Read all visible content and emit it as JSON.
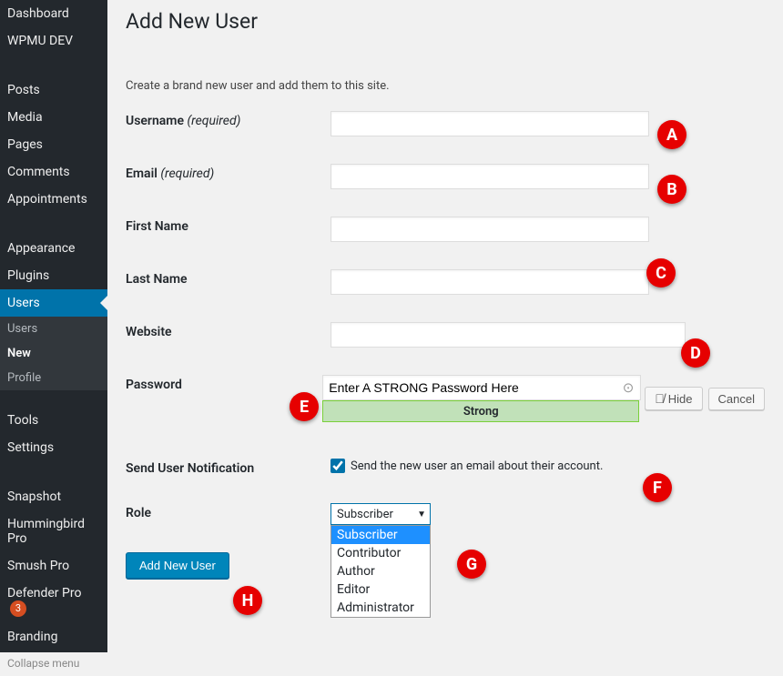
{
  "sidebar": {
    "items": [
      {
        "label": "Dashboard"
      },
      {
        "label": "WPMU DEV"
      },
      {
        "label": "Posts"
      },
      {
        "label": "Media"
      },
      {
        "label": "Pages"
      },
      {
        "label": "Comments"
      },
      {
        "label": "Appointments"
      },
      {
        "label": "Appearance"
      },
      {
        "label": "Plugins"
      },
      {
        "label": "Users",
        "current": true
      },
      {
        "label": "Tools"
      },
      {
        "label": "Settings"
      },
      {
        "label": "Snapshot"
      },
      {
        "label": "Hummingbird Pro"
      },
      {
        "label": "Smush Pro"
      },
      {
        "label": "Defender Pro",
        "badge": "3"
      },
      {
        "label": "Branding"
      },
      {
        "label": "Collapse menu"
      }
    ],
    "users_sub": [
      {
        "label": "Users"
      },
      {
        "label": "New",
        "current": true
      },
      {
        "label": "Profile"
      }
    ]
  },
  "page": {
    "title": "Add New User",
    "description": "Create a brand new user and add them to this site."
  },
  "form": {
    "username_label": "Username",
    "username_req": "(required)",
    "email_label": "Email",
    "email_req": "(required)",
    "firstname_label": "First Name",
    "lastname_label": "Last Name",
    "website_label": "Website",
    "password_label": "Password",
    "password_value": "Enter A STRONG Password Here",
    "password_strength": "Strong",
    "hide_btn": "Hide",
    "cancel_btn": "Cancel",
    "notif_label": "Send User Notification",
    "notif_text": "Send the new user an email about their account.",
    "role_label": "Role",
    "role_selected": "Subscriber",
    "role_options": [
      "Subscriber",
      "Contributor",
      "Author",
      "Editor",
      "Administrator"
    ],
    "submit_btn": "Add New User"
  },
  "markers": {
    "A": "A",
    "B": "B",
    "C": "C",
    "D": "D",
    "E": "E",
    "F": "F",
    "G": "G",
    "H": "H"
  }
}
